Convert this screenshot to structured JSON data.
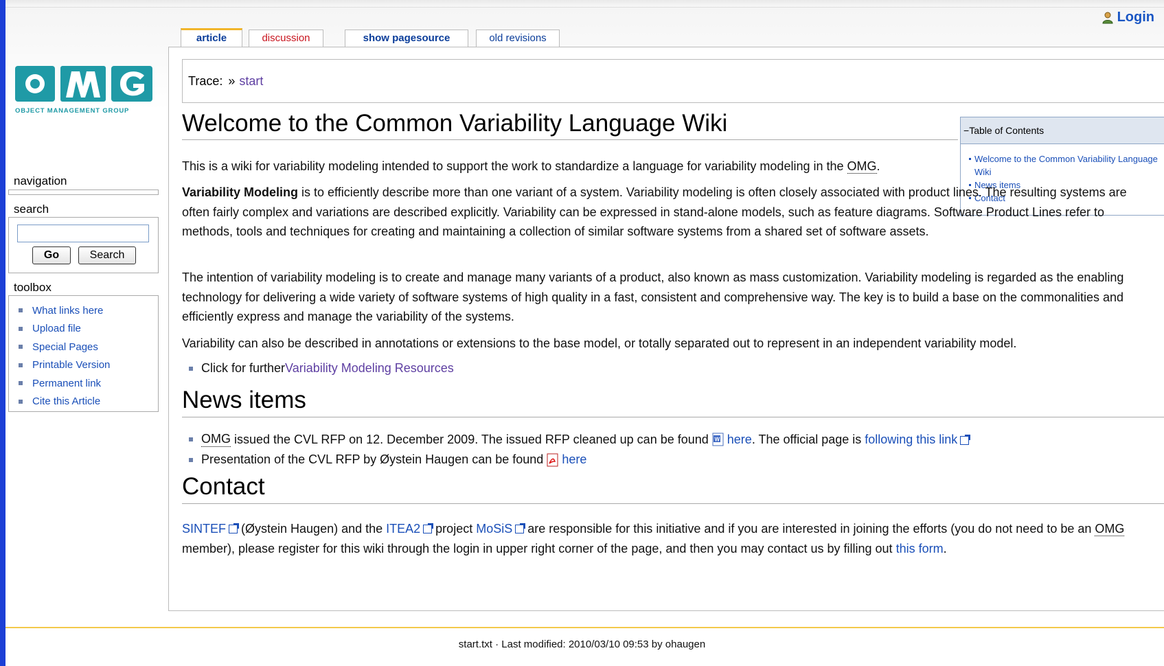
{
  "header": {
    "login_label": "Login"
  },
  "tabs": [
    {
      "label": "article"
    },
    {
      "label": "discussion"
    },
    {
      "label": "show pagesource"
    },
    {
      "label": "old revisions"
    }
  ],
  "trace": {
    "label": "Trace:",
    "separator": "»",
    "crumb": "start"
  },
  "logo": {
    "text": "OMG",
    "subtext": "OBJECT MANAGEMENT GROUP"
  },
  "sidebar": {
    "navigation_label": "navigation",
    "search_label": "search",
    "search_value": "",
    "go_label": "Go",
    "search_button_label": "Search",
    "toolbox_label": "toolbox",
    "toolbox_items": [
      {
        "label": "What links here"
      },
      {
        "label": "Upload file"
      },
      {
        "label": "Special Pages"
      },
      {
        "label": "Printable Version"
      },
      {
        "label": "Permanent link"
      },
      {
        "label": "Cite this Article"
      }
    ]
  },
  "toc": {
    "title": "Table of Contents",
    "toggle": "−",
    "items": [
      {
        "label": "Welcome to the Common Variability Language Wiki"
      },
      {
        "label": "News items"
      },
      {
        "label": "Contact"
      }
    ]
  },
  "article": {
    "title": "Welcome to the Common Variability Language Wiki",
    "p1_text": "This is a wiki for variability modeling intended to support the work to standardize a language for variability modeling in the ",
    "p1_abbr": "OMG",
    "p1_end": ".",
    "p2_bold": "Variability Modeling",
    "p2_text": " is to efficiently describe more than one variant of a system. Variability modeling is often closely associated with product lines. The resulting systems are often fairly complex and variations are described explicitly. Variability can be expressed in stand-alone models, such as feature diagrams. Software Product Lines refer to methods, tools and techniques for creating and maintaining a collection of similar software systems from a shared set of software assets.",
    "p3": "The intention of variability modeling is to create and manage many variants of a product, also known as mass customization. Variability modeling is regarded as the enabling technology for delivering a wide variety of software systems of high quality in a fast, consistent and comprehensive way. The key is to build a base on the commonalities and efficiently express and manage the variability of the systems.",
    "p4": "Variability can also be described in annotations or extensions to the base model, or totally separated out to represent in an independent variability model.",
    "bullet1_text": "Click for further ",
    "bullet1_link": "Variability Modeling Resources"
  },
  "news": {
    "title": "News items",
    "item1_abbr": "OMG",
    "item1_text": " issued the CVL RFP on 12. December 2009. The issued RFP cleaned up can be found ",
    "item1_link": "here",
    "item1_text2": ". The official page is ",
    "item1_link2": "following this link",
    "item2_text": "Presentation of the CVL RFP by Øystein Haugen can be found ",
    "item2_link": "here"
  },
  "contact": {
    "title": "Contact",
    "link_sintef": "SINTEF",
    "t1": " (Øystein Haugen) and the ",
    "link_itea": "ITEA2",
    "t2": " project ",
    "link_mosis": "MoSiS",
    "t3": " are responsible for this initiative and if you are interested in joining the efforts (you do not need to be an ",
    "abbr": "OMG",
    "t4": " member), please register for this wiki through the login in upper right corner of the page, and then you may contact us by filling out ",
    "link_form": "this form",
    "t5": "."
  },
  "footer": {
    "text": "start.txt · Last modified: 2010/03/10 09:53 by ohaugen"
  }
}
